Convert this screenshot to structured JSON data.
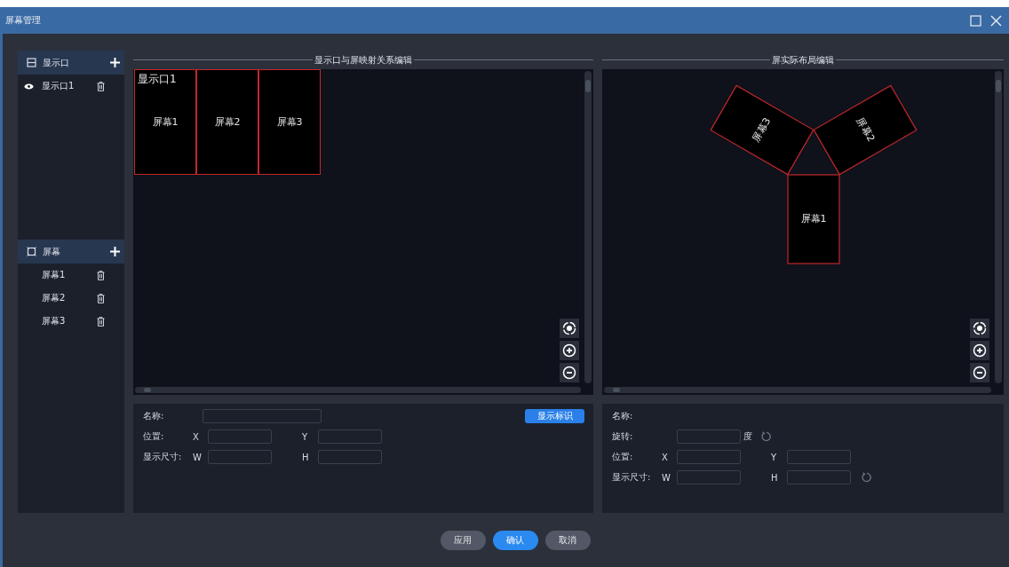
{
  "window": {
    "title": "屏幕管理"
  },
  "sidebar": {
    "outputs": {
      "title": "显示口",
      "items": [
        {
          "label": "显示口1",
          "visible": true
        }
      ]
    },
    "screens": {
      "title": "屏幕",
      "items": [
        {
          "label": "屏幕1"
        },
        {
          "label": "屏幕2"
        },
        {
          "label": "屏幕3"
        }
      ]
    }
  },
  "mapping_editor": {
    "title": "显示口与屏映射关系编辑",
    "output_label": "显示口1",
    "screens": [
      "屏幕1",
      "屏幕2",
      "屏幕3"
    ],
    "form": {
      "name_label": "名称:",
      "identify_button": "显示标识",
      "rows": [
        {
          "label": "位置:",
          "fields": [
            "X",
            "Y"
          ]
        },
        {
          "label": "显示尺寸:",
          "fields": [
            "W",
            "H"
          ]
        }
      ]
    }
  },
  "layout_editor": {
    "title": "屏实际布局编辑",
    "screens": [
      "屏幕1",
      "屏幕2",
      "屏幕3"
    ],
    "form": {
      "name_label": "名称:",
      "rotation_label": "旋转:",
      "rotation_unit": "度",
      "rows": [
        {
          "label": "位置:",
          "fields": [
            "X",
            "Y"
          ],
          "reset": false
        },
        {
          "label": "显示尺寸:",
          "fields": [
            "W",
            "H"
          ],
          "reset": true
        }
      ]
    }
  },
  "buttons": [
    {
      "label": "应用",
      "primary": false
    },
    {
      "label": "确认",
      "primary": true
    },
    {
      "label": "取消",
      "primary": false
    }
  ]
}
